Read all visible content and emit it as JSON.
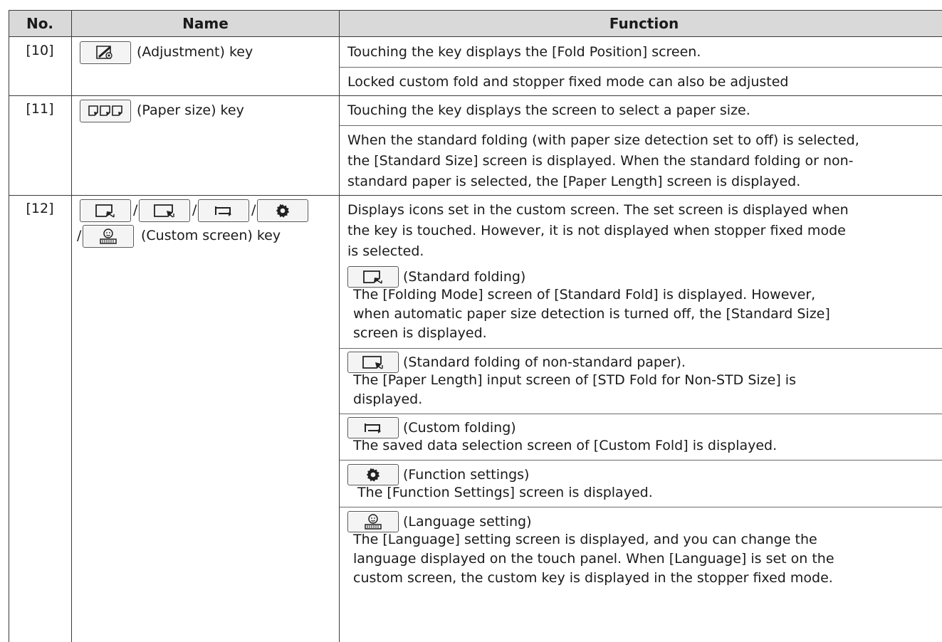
{
  "header": {
    "no": "No.",
    "name": "Name",
    "function": "Function"
  },
  "rows": [
    {
      "no": "[10]",
      "name": "(Adjustment) key",
      "icon": "adjustment-icon",
      "lines": [
        "Touching the key displays the [Fold Position] screen.",
        "Locked custom fold and stopper fixed mode can also be adjusted"
      ]
    },
    {
      "no": "[11]",
      "name": "(Paper size) key",
      "icon": "paper-size-icon",
      "lines": [
        "Touching the key displays the screen to select a paper size.",
        "When the standard folding (with paper size detection set to off) is selected,",
        "the [Standard Size] screen is displayed.  When the standard folding or non-",
        "standard paper is selected, the [Paper Length] screen is displayed."
      ]
    },
    {
      "no": "[12]",
      "name": "(Custom screen) key",
      "sep": "/",
      "icons": [
        "standard-folding-icon",
        "nonstandard-folding-icon",
        "custom-folding-icon",
        "gear-icon",
        "language-icon"
      ],
      "intro": [
        "Displays icons set in the custom screen. The set screen is displayed when",
        "the key is touched. However, it is not displayed when stopper fixed mode",
        "is selected."
      ],
      "items": [
        {
          "label": "(Standard folding)",
          "icon": "standard-folding-icon",
          "desc": [
            "The [Folding Mode] screen of [Standard Fold] is displayed. However,",
            "when automatic paper size detection is turned off, the [Standard Size]",
            "screen is displayed."
          ]
        },
        {
          "label": "(Standard folding of non-standard paper).",
          "icon": "nonstandard-folding-icon",
          "desc": [
            "The [Paper Length] input screen of [STD Fold for Non-STD Size] is",
            "displayed."
          ]
        },
        {
          "label": "(Custom folding)",
          "icon": "custom-folding-icon",
          "desc": [
            "The saved data selection screen of [Custom Fold] is displayed."
          ]
        },
        {
          "label": "(Function settings)",
          "icon": "gear-icon",
          "desc": [
            " The [Function Settings] screen is displayed."
          ]
        },
        {
          "label": "(Language setting)",
          "icon": "language-icon",
          "desc": [
            "The [Language] setting screen is displayed, and you can change the",
            "language displayed on the touch panel. When [Language] is set on the",
            "custom screen, the custom key is displayed in the stopper fixed mode."
          ]
        }
      ]
    }
  ],
  "colors": {
    "header_bg": "#d9d9d9",
    "border": "#3a3a3a",
    "text": "#1a1a1a"
  }
}
